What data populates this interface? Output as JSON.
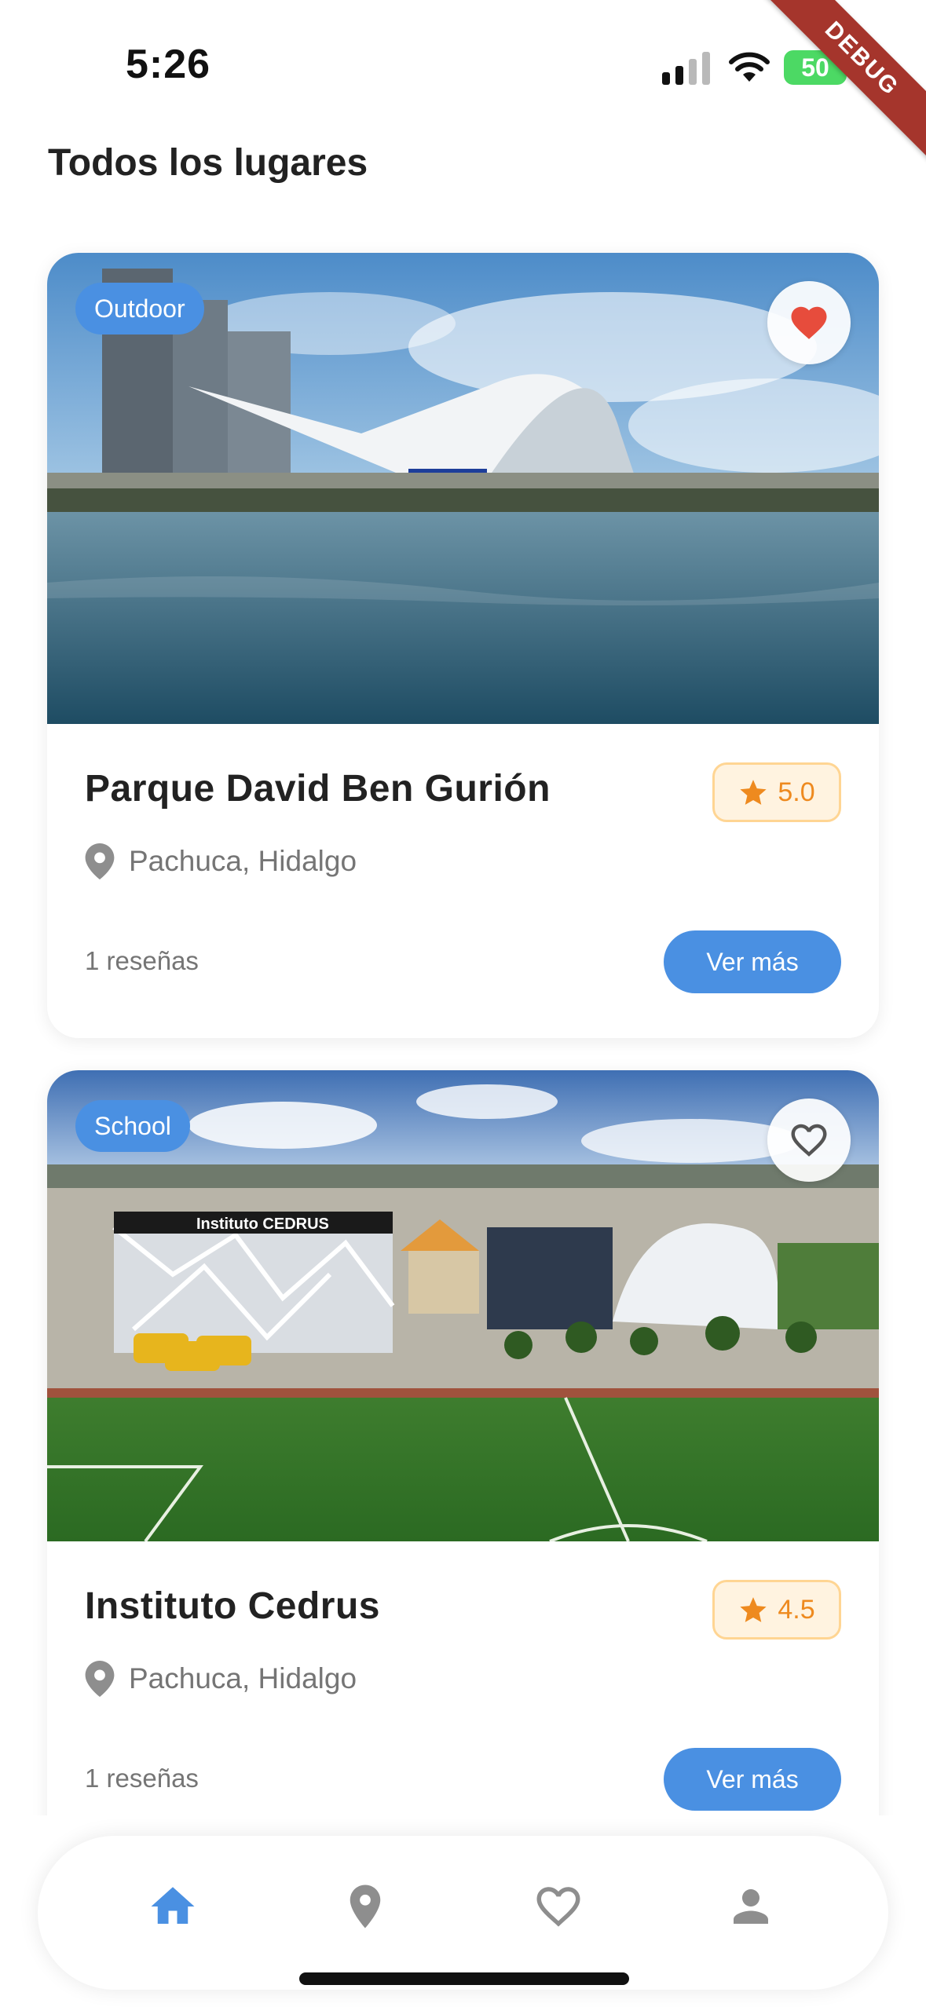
{
  "status_bar": {
    "time": "5:26",
    "battery": "50",
    "debug_label": "DEBUG"
  },
  "page": {
    "title": "Todos los lugares"
  },
  "places": [
    {
      "category": "Outdoor",
      "name": "Parque David Ben Gurión",
      "rating": "5.0",
      "location": "Pachuca, Hidalgo",
      "reviews": "1 reseñas",
      "button_label": "Ver más",
      "favorite": true
    },
    {
      "category": "School",
      "name": "Instituto Cedrus",
      "rating": "4.5",
      "location": "Pachuca, Hidalgo",
      "reviews": "1 reseñas",
      "button_label": "Ver más",
      "favorite": false,
      "image_sign": "Instituto CEDRUS"
    }
  ],
  "nav": {
    "items": [
      {
        "icon": "home-icon",
        "active": true
      },
      {
        "icon": "location-pin-icon",
        "active": false
      },
      {
        "icon": "heart-outline-icon",
        "active": false
      },
      {
        "icon": "person-icon",
        "active": false
      }
    ]
  },
  "colors": {
    "accent": "#4a90e2",
    "favorite_red": "#e74c3c",
    "rating_orange": "#ee8a1f",
    "rating_bg": "#fff3e0",
    "muted_text": "#757575",
    "inactive_icon": "#8e8e8e"
  }
}
